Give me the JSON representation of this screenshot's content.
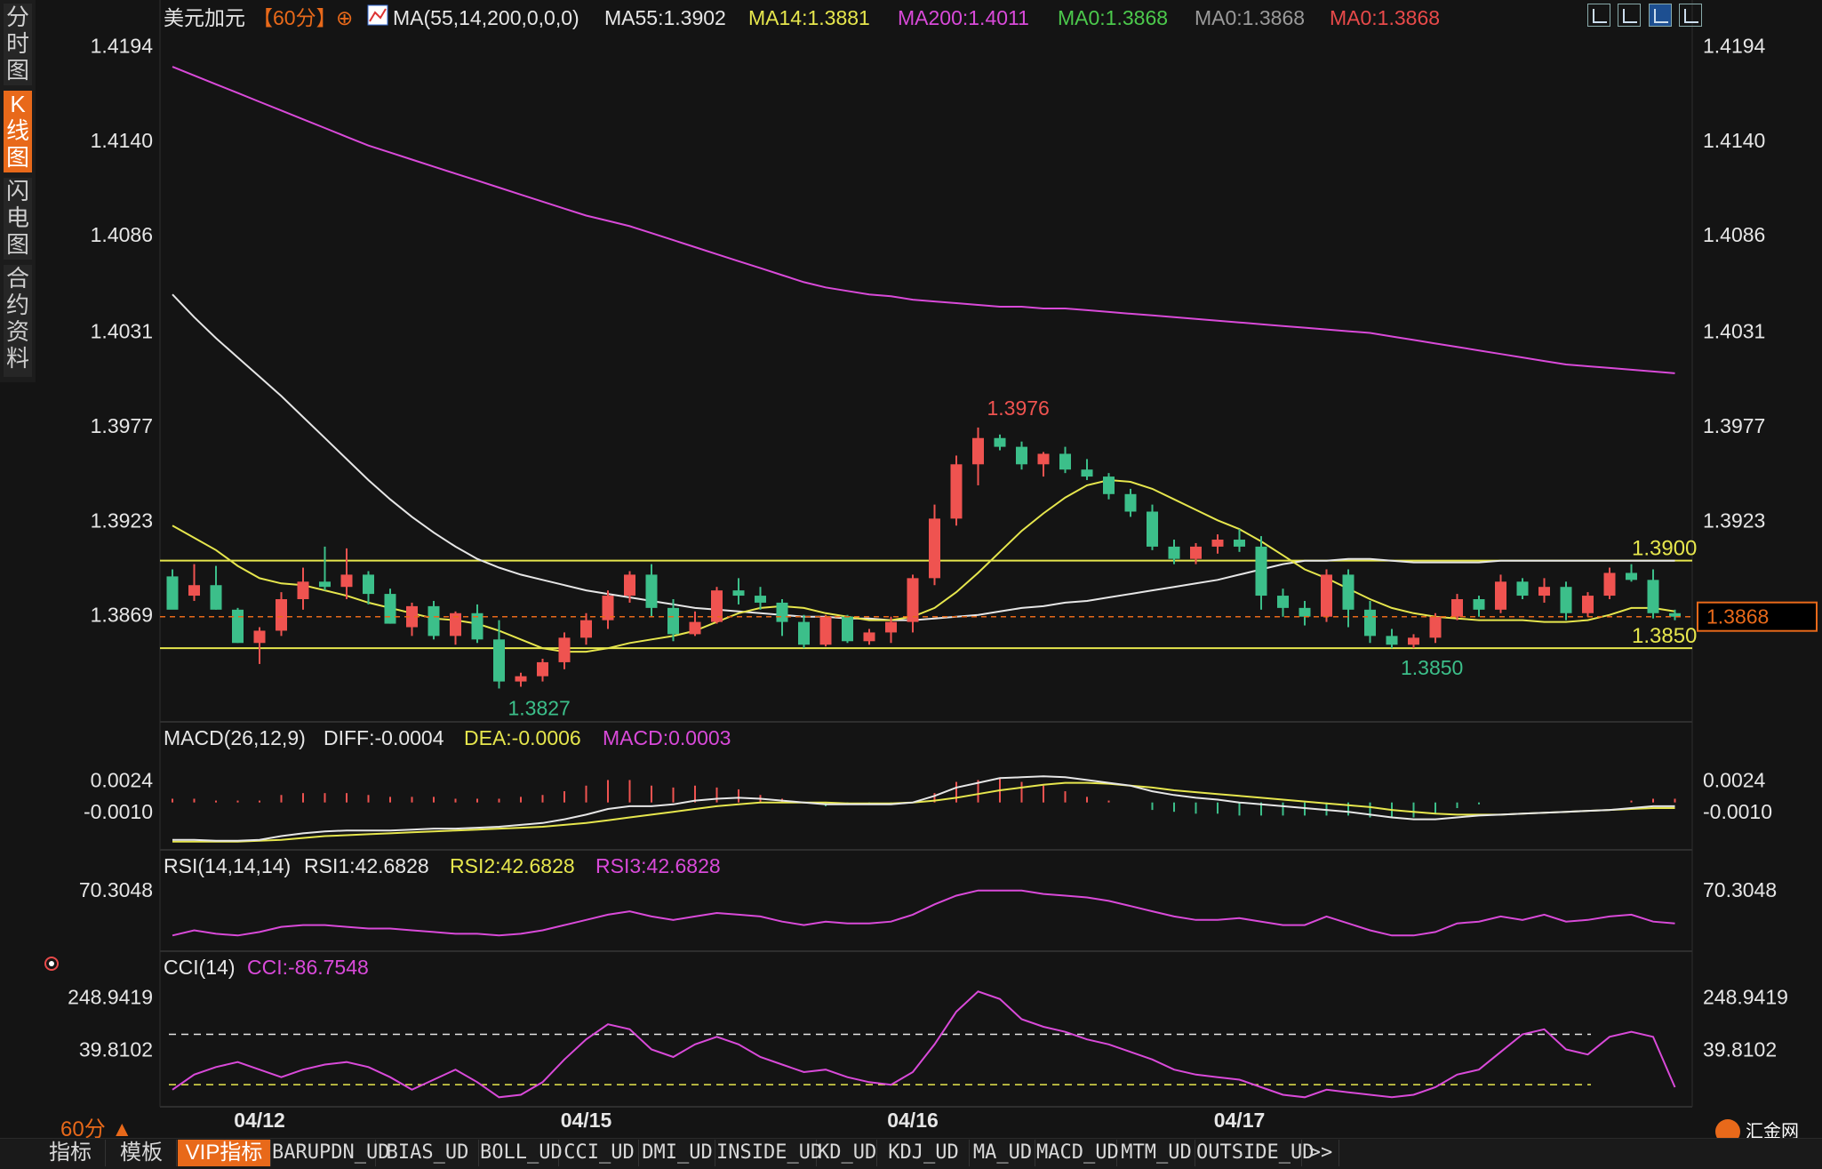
{
  "sidebar": {
    "tabs": [
      {
        "label": "分时图",
        "active": false
      },
      {
        "label": "K线图",
        "active": true
      },
      {
        "label": "闪电图",
        "active": false
      },
      {
        "label": "合约资料",
        "active": false
      }
    ]
  },
  "header": {
    "symbol": "美元加元",
    "period": "【60分】",
    "ma_params": "MA(55,14,200,0,0,0)",
    "ma55": "MA55:1.3902",
    "ma14": "MA14:1.3881",
    "ma200": "MA200:1.4011",
    "ma0a": "MA0:1.3868",
    "ma0b": "MA0:1.3868",
    "ma0c": "MA0:1.3868"
  },
  "colors": {
    "up": "#ef5350",
    "down": "#3cbf8a",
    "ma14": "#e6e64d",
    "ma55": "#e6e6e6",
    "ma200": "#d94ad9",
    "level": "#e6e64d",
    "accent": "#e8691a"
  },
  "indicators": {
    "macd_title": "MACD(26,12,9)",
    "macd_diff": "DIFF:-0.0004",
    "macd_dea": "DEA:-0.0006",
    "macd_macd": "MACD:0.0003",
    "rsi_title": "RSI(14,14,14)",
    "rsi1": "RSI1:42.6828",
    "rsi2": "RSI2:42.6828",
    "rsi3": "RSI3:42.6828",
    "cci_title": "CCI(14)",
    "cci_value": "CCI:-86.7548"
  },
  "footer": {
    "period_label": "60分 ▲",
    "logo": "汇金网",
    "tabs": [
      {
        "label": "指标",
        "active": false
      },
      {
        "label": "模板",
        "active": false
      },
      {
        "label": "VIP指标",
        "active": true
      },
      {
        "label": "BARUPDN_UD",
        "active": false
      },
      {
        "label": "BIAS_UD",
        "active": false
      },
      {
        "label": "BOLL_UD",
        "active": false
      },
      {
        "label": "CCI_UD",
        "active": false
      },
      {
        "label": "DMI_UD",
        "active": false
      },
      {
        "label": "INSIDE_UD",
        "active": false
      },
      {
        "label": "KD_UD",
        "active": false
      },
      {
        "label": "KDJ_UD",
        "active": false
      },
      {
        "label": "MA_UD",
        "active": false
      },
      {
        "label": "MACD_UD",
        "active": false
      },
      {
        "label": "MTM_UD",
        "active": false
      },
      {
        "label": "OUTSIDE_UD",
        "active": false
      },
      {
        "label": ">>",
        "active": false
      }
    ]
  },
  "chart_data": {
    "type": "candlestick",
    "x_ticks": [
      "04/12",
      "04/15",
      "04/16",
      "04/17"
    ],
    "x_tick_index": [
      4,
      19,
      34,
      49
    ],
    "price_axis": {
      "ticks": [
        1.4194,
        1.414,
        1.4086,
        1.4031,
        1.3977,
        1.3923,
        1.3869
      ],
      "labels": [
        "1.4194",
        "1.4140",
        "1.4086",
        "1.4031",
        "1.3977",
        "1.3923",
        "1.3869"
      ],
      "range": [
        1.3811,
        1.4213
      ]
    },
    "last_price": "1.3868",
    "last_price_value": 1.3868,
    "levels": [
      {
        "value": 1.39,
        "label": "1.3900"
      },
      {
        "value": 1.385,
        "label": "1.3850"
      }
    ],
    "annotations": [
      {
        "index": 37,
        "value": 1.3976,
        "label": "1.3976"
      },
      {
        "index": 15,
        "value": 1.3827,
        "label": "1.3827"
      },
      {
        "index": 56,
        "value": 1.385,
        "label": "1.3850"
      }
    ],
    "candles": [
      [
        1.3891,
        1.3895,
        1.3875,
        1.3872
      ],
      [
        1.388,
        1.3898,
        1.3877,
        1.3886
      ],
      [
        1.3886,
        1.3897,
        1.3872,
        1.3872
      ],
      [
        1.3872,
        1.3873,
        1.3853,
        1.3853
      ],
      [
        1.3853,
        1.3862,
        1.3841,
        1.386
      ],
      [
        1.386,
        1.3882,
        1.3857,
        1.3878
      ],
      [
        1.3878,
        1.3896,
        1.3872,
        1.3888
      ],
      [
        1.3888,
        1.3908,
        1.3883,
        1.3885
      ],
      [
        1.3885,
        1.3907,
        1.3878,
        1.3892
      ],
      [
        1.3892,
        1.3894,
        1.3875,
        1.3881
      ],
      [
        1.3881,
        1.3884,
        1.3864,
        1.3864
      ],
      [
        1.3862,
        1.3876,
        1.3857,
        1.3874
      ],
      [
        1.3874,
        1.3877,
        1.3855,
        1.3857
      ],
      [
        1.3857,
        1.3871,
        1.3852,
        1.387
      ],
      [
        1.387,
        1.3875,
        1.3853,
        1.3855
      ],
      [
        1.3855,
        1.3866,
        1.3827,
        1.3831
      ],
      [
        1.3831,
        1.3836,
        1.3828,
        1.3834
      ],
      [
        1.3834,
        1.3844,
        1.3831,
        1.3842
      ],
      [
        1.3842,
        1.3859,
        1.3838,
        1.3856
      ],
      [
        1.3856,
        1.387,
        1.3852,
        1.3866
      ],
      [
        1.3866,
        1.3883,
        1.3861,
        1.388
      ],
      [
        1.388,
        1.3894,
        1.3876,
        1.3892
      ],
      [
        1.3892,
        1.3898,
        1.3868,
        1.3873
      ],
      [
        1.3873,
        1.3878,
        1.3854,
        1.3858
      ],
      [
        1.3858,
        1.3871,
        1.3857,
        1.3865
      ],
      [
        1.3865,
        1.3885,
        1.3864,
        1.3883
      ],
      [
        1.3883,
        1.389,
        1.3875,
        1.388
      ],
      [
        1.388,
        1.3885,
        1.3872,
        1.3876
      ],
      [
        1.3876,
        1.3878,
        1.3857,
        1.3865
      ],
      [
        1.3865,
        1.3869,
        1.385,
        1.3852
      ],
      [
        1.3852,
        1.3869,
        1.3851,
        1.3868
      ],
      [
        1.3868,
        1.3869,
        1.3853,
        1.3854
      ],
      [
        1.3854,
        1.3861,
        1.3852,
        1.3859
      ],
      [
        1.3859,
        1.3868,
        1.3853,
        1.3865
      ],
      [
        1.3865,
        1.3892,
        1.3859,
        1.389
      ],
      [
        1.389,
        1.3932,
        1.3886,
        1.3924
      ],
      [
        1.3924,
        1.396,
        1.392,
        1.3955
      ],
      [
        1.3955,
        1.3976,
        1.3943,
        1.397
      ],
      [
        1.397,
        1.3972,
        1.3963,
        1.3965
      ],
      [
        1.3965,
        1.3968,
        1.3952,
        1.3955
      ],
      [
        1.3955,
        1.3962,
        1.3948,
        1.3961
      ],
      [
        1.3961,
        1.3965,
        1.395,
        1.3952
      ],
      [
        1.3952,
        1.3958,
        1.3946,
        1.3948
      ],
      [
        1.3948,
        1.395,
        1.3935,
        1.3938
      ],
      [
        1.3938,
        1.3941,
        1.3925,
        1.3928
      ],
      [
        1.3928,
        1.3932,
        1.3906,
        1.3908
      ],
      [
        1.3908,
        1.3912,
        1.3898,
        1.3901
      ],
      [
        1.3901,
        1.391,
        1.3898,
        1.3908
      ],
      [
        1.3908,
        1.3915,
        1.3904,
        1.3912
      ],
      [
        1.3912,
        1.3918,
        1.3905,
        1.3908
      ],
      [
        1.3908,
        1.3914,
        1.3872,
        1.388
      ],
      [
        1.388,
        1.3884,
        1.3868,
        1.3873
      ],
      [
        1.3873,
        1.3877,
        1.3863,
        1.3868
      ],
      [
        1.3868,
        1.3895,
        1.3865,
        1.3892
      ],
      [
        1.3892,
        1.3895,
        1.3862,
        1.3872
      ],
      [
        1.3872,
        1.3877,
        1.3853,
        1.3857
      ],
      [
        1.3857,
        1.3861,
        1.385,
        1.3852
      ],
      [
        1.3852,
        1.3858,
        1.385,
        1.3856
      ],
      [
        1.3856,
        1.387,
        1.3853,
        1.3868
      ],
      [
        1.3868,
        1.3881,
        1.3866,
        1.3878
      ],
      [
        1.3878,
        1.388,
        1.3868,
        1.3872
      ],
      [
        1.3872,
        1.3892,
        1.387,
        1.3888
      ],
      [
        1.3888,
        1.389,
        1.3878,
        1.388
      ],
      [
        1.388,
        1.389,
        1.3876,
        1.3885
      ],
      [
        1.3885,
        1.3888,
        1.3866,
        1.387
      ],
      [
        1.387,
        1.3882,
        1.3868,
        1.388
      ],
      [
        1.388,
        1.3896,
        1.3878,
        1.3893
      ],
      [
        1.3893,
        1.3898,
        1.3888,
        1.3889
      ],
      [
        1.3889,
        1.3895,
        1.3867,
        1.387
      ],
      [
        1.387,
        1.3872,
        1.3866,
        1.3868
      ]
    ],
    "ma14": [
      1.392,
      1.3913,
      1.3906,
      1.3897,
      1.389,
      1.3887,
      1.3886,
      1.3883,
      1.388,
      1.3876,
      1.3873,
      1.387,
      1.3867,
      1.3866,
      1.3864,
      1.386,
      1.3855,
      1.385,
      1.3848,
      1.3848,
      1.385,
      1.3853,
      1.3855,
      1.3857,
      1.386,
      1.3865,
      1.387,
      1.3873,
      1.3874,
      1.3873,
      1.387,
      1.3868,
      1.3866,
      1.3866,
      1.3868,
      1.3873,
      1.3882,
      1.3893,
      1.3905,
      1.3917,
      1.3927,
      1.3936,
      1.3943,
      1.3946,
      1.3945,
      1.3941,
      1.3935,
      1.3929,
      1.3923,
      1.3918,
      1.3911,
      1.3903,
      1.3895,
      1.389,
      1.3884,
      1.3878,
      1.3873,
      1.387,
      1.3868,
      1.3867,
      1.3866,
      1.3866,
      1.3866,
      1.3865,
      1.3865,
      1.3866,
      1.3869,
      1.3873,
      1.3873,
      1.3871
    ],
    "ma55": [
      1.4052,
      1.4039,
      1.4027,
      1.4016,
      1.4005,
      1.3994,
      1.3982,
      1.397,
      1.3958,
      1.3946,
      1.3935,
      1.3925,
      1.3916,
      1.3908,
      1.3901,
      1.3896,
      1.3892,
      1.3889,
      1.3886,
      1.3883,
      1.3881,
      1.3879,
      1.3877,
      1.3875,
      1.3873,
      1.3872,
      1.3871,
      1.387,
      1.3869,
      1.3868,
      1.3868,
      1.3867,
      1.3867,
      1.3866,
      1.3866,
      1.3867,
      1.3868,
      1.3869,
      1.3871,
      1.3873,
      1.3874,
      1.3876,
      1.3877,
      1.3879,
      1.3881,
      1.3883,
      1.3885,
      1.3887,
      1.3889,
      1.3892,
      1.3895,
      1.3898,
      1.39,
      1.39,
      1.3901,
      1.3901,
      1.39,
      1.3899,
      1.3899,
      1.3899,
      1.3899,
      1.39,
      1.39,
      1.39,
      1.39,
      1.39,
      1.39,
      1.39,
      1.39,
      1.39
    ],
    "ma200": [
      1.4182,
      1.4177,
      1.4172,
      1.4167,
      1.4162,
      1.4157,
      1.4152,
      1.4147,
      1.4142,
      1.4137,
      1.4133,
      1.4129,
      1.4125,
      1.4121,
      1.4117,
      1.4113,
      1.4109,
      1.4105,
      1.4101,
      1.4097,
      1.4094,
      1.4091,
      1.4087,
      1.4083,
      1.4079,
      1.4075,
      1.4071,
      1.4067,
      1.4063,
      1.4059,
      1.4056,
      1.4054,
      1.4052,
      1.4051,
      1.4049,
      1.4048,
      1.4047,
      1.4046,
      1.4045,
      1.4045,
      1.4044,
      1.4044,
      1.4043,
      1.4042,
      1.4041,
      1.404,
      1.4039,
      1.4038,
      1.4037,
      1.4036,
      1.4035,
      1.4034,
      1.4033,
      1.4032,
      1.4031,
      1.403,
      1.4028,
      1.4026,
      1.4024,
      1.4022,
      1.402,
      1.4018,
      1.4016,
      1.4014,
      1.4012,
      1.4011,
      1.401,
      1.4009,
      1.4008,
      1.4007
    ],
    "macd": {
      "ticks": [
        0.0024,
        -0.001
      ],
      "labels": [
        "0.0024",
        "-0.0010"
      ],
      "range": [
        -0.0045,
        0.0052
      ],
      "diff": [
        -0.004,
        -0.004,
        -0.0041,
        -0.0041,
        -0.004,
        -0.0036,
        -0.0033,
        -0.0031,
        -0.003,
        -0.003,
        -0.003,
        -0.0029,
        -0.0028,
        -0.0028,
        -0.0027,
        -0.0026,
        -0.0024,
        -0.0022,
        -0.0018,
        -0.0013,
        -0.0007,
        -0.0004,
        -0.0004,
        -0.0002,
        0.0002,
        0.0004,
        0.0005,
        0.0004,
        0.0002,
        0.0,
        -0.0002,
        -0.0002,
        -0.0002,
        -0.0002,
        0.0,
        0.0007,
        0.0016,
        0.0021,
        0.0026,
        0.0027,
        0.0028,
        0.0027,
        0.0024,
        0.0021,
        0.0018,
        0.0012,
        0.0008,
        0.0005,
        0.0003,
        0.0,
        -0.0002,
        -0.0004,
        -0.0006,
        -0.0008,
        -0.001,
        -0.0013,
        -0.0016,
        -0.0018,
        -0.0018,
        -0.0016,
        -0.0014,
        -0.0013,
        -0.0012,
        -0.0011,
        -0.001,
        -0.0009,
        -0.0008,
        -0.0006,
        -0.0004,
        -0.0004
      ],
      "dea": [
        -0.0042,
        -0.0042,
        -0.0042,
        -0.0042,
        -0.0041,
        -0.004,
        -0.0038,
        -0.0036,
        -0.0035,
        -0.0034,
        -0.0033,
        -0.0032,
        -0.0031,
        -0.003,
        -0.0029,
        -0.0028,
        -0.0027,
        -0.0026,
        -0.0024,
        -0.0022,
        -0.0019,
        -0.0016,
        -0.0013,
        -0.001,
        -0.0007,
        -0.0004,
        -0.0002,
        0.0,
        0.0,
        0.0,
        0.0,
        -0.0001,
        -0.0001,
        -0.0001,
        0.0,
        0.0002,
        0.0005,
        0.0009,
        0.0013,
        0.0016,
        0.0019,
        0.0021,
        0.0021,
        0.002,
        0.0018,
        0.0016,
        0.0013,
        0.0011,
        0.0009,
        0.0007,
        0.0005,
        0.0003,
        0.0001,
        -0.0001,
        -0.0003,
        -0.0005,
        -0.0008,
        -0.001,
        -0.0012,
        -0.0013,
        -0.0013,
        -0.0013,
        -0.0012,
        -0.0011,
        -0.001,
        -0.0009,
        -0.0008,
        -0.0007,
        -0.0006,
        -0.0006
      ],
      "hist": [
        0.0004,
        0.0004,
        0.0002,
        0.0002,
        0.0002,
        0.0008,
        0.001,
        0.001,
        0.001,
        0.0008,
        0.0006,
        0.0006,
        0.0006,
        0.0004,
        0.0004,
        0.0004,
        0.0006,
        0.0008,
        0.0012,
        0.0018,
        0.0024,
        0.0024,
        0.0018,
        0.0016,
        0.0018,
        0.0016,
        0.0014,
        0.0008,
        0.0004,
        0.0,
        -0.0004,
        -0.0002,
        -0.0002,
        -0.0002,
        0.0,
        0.001,
        0.0022,
        0.0024,
        0.0026,
        0.0022,
        0.0018,
        0.0012,
        0.0006,
        0.0002,
        0.0,
        -0.0008,
        -0.001,
        -0.0012,
        -0.0012,
        -0.0014,
        -0.0014,
        -0.0014,
        -0.0014,
        -0.0014,
        -0.0014,
        -0.0016,
        -0.0016,
        -0.0016,
        -0.0012,
        -0.0006,
        -0.0002,
        0.0,
        0.0,
        0.0,
        0.0,
        0.0,
        0.0,
        0.0002,
        0.0004,
        0.0004
      ]
    },
    "rsi": {
      "ticks": [
        70.3048
      ],
      "labels": [
        "70.3048"
      ],
      "range": [
        38,
        76
      ],
      "values": [
        44,
        47,
        45,
        44,
        46,
        49,
        50,
        50,
        49,
        48,
        48,
        47,
        46,
        45,
        45,
        44,
        45,
        47,
        50,
        53,
        56,
        58,
        55,
        53,
        55,
        57,
        56,
        55,
        52,
        50,
        52,
        51,
        51,
        52,
        56,
        62,
        67,
        70,
        70,
        70,
        68,
        67,
        66,
        64,
        61,
        58,
        55,
        53,
        53,
        54,
        52,
        50,
        50,
        55,
        51,
        47,
        44,
        44,
        46,
        51,
        52,
        55,
        53,
        56,
        52,
        53,
        55,
        56,
        52,
        51
      ]
    },
    "cci": {
      "ticks": [
        248.9419,
        39.8102
      ],
      "labels": [
        "248.9419",
        "39.8102"
      ],
      "range": [
        -170,
        310
      ],
      "upper": 100,
      "lower": -100,
      "values": [
        -120,
        -60,
        -30,
        -10,
        -40,
        -70,
        -40,
        -20,
        -10,
        -30,
        -70,
        -120,
        -80,
        -40,
        -90,
        -150,
        -140,
        -90,
        0,
        80,
        140,
        120,
        40,
        10,
        60,
        90,
        60,
        10,
        -20,
        -50,
        -40,
        -70,
        -90,
        -100,
        -50,
        60,
        190,
        270,
        240,
        160,
        130,
        110,
        80,
        60,
        30,
        0,
        -40,
        -60,
        -70,
        -80,
        -110,
        -140,
        -150,
        -120,
        -130,
        -140,
        -150,
        -140,
        -110,
        -60,
        -40,
        30,
        100,
        120,
        40,
        20,
        90,
        110,
        90,
        -110
      ]
    }
  }
}
